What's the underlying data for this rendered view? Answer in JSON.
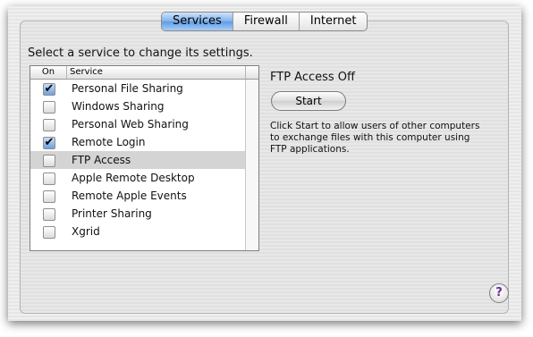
{
  "tabs": [
    "Services",
    "Firewall",
    "Internet"
  ],
  "active_tab": "Services",
  "instruction": "Select a service to change its settings.",
  "list": {
    "headers": {
      "on": "On",
      "service": "Service"
    },
    "services": [
      {
        "name": "Personal File Sharing",
        "checked": true,
        "selected": false
      },
      {
        "name": "Windows Sharing",
        "checked": false,
        "selected": false
      },
      {
        "name": "Personal Web Sharing",
        "checked": false,
        "selected": false
      },
      {
        "name": "Remote Login",
        "checked": true,
        "selected": false
      },
      {
        "name": "FTP Access",
        "checked": false,
        "selected": true
      },
      {
        "name": "Apple Remote Desktop",
        "checked": false,
        "selected": false
      },
      {
        "name": "Remote Apple Events",
        "checked": false,
        "selected": false
      },
      {
        "name": "Printer Sharing",
        "checked": false,
        "selected": false
      },
      {
        "name": "Xgrid",
        "checked": false,
        "selected": false
      }
    ]
  },
  "detail": {
    "status": "FTP Access Off",
    "start_button": "Start",
    "description": "Click Start to allow users of other computers to exchange files with this computer using FTP applications."
  },
  "help_icon": "?",
  "colors": {
    "accent": "#5f9be6",
    "selected_row": "#d4d4d4"
  }
}
